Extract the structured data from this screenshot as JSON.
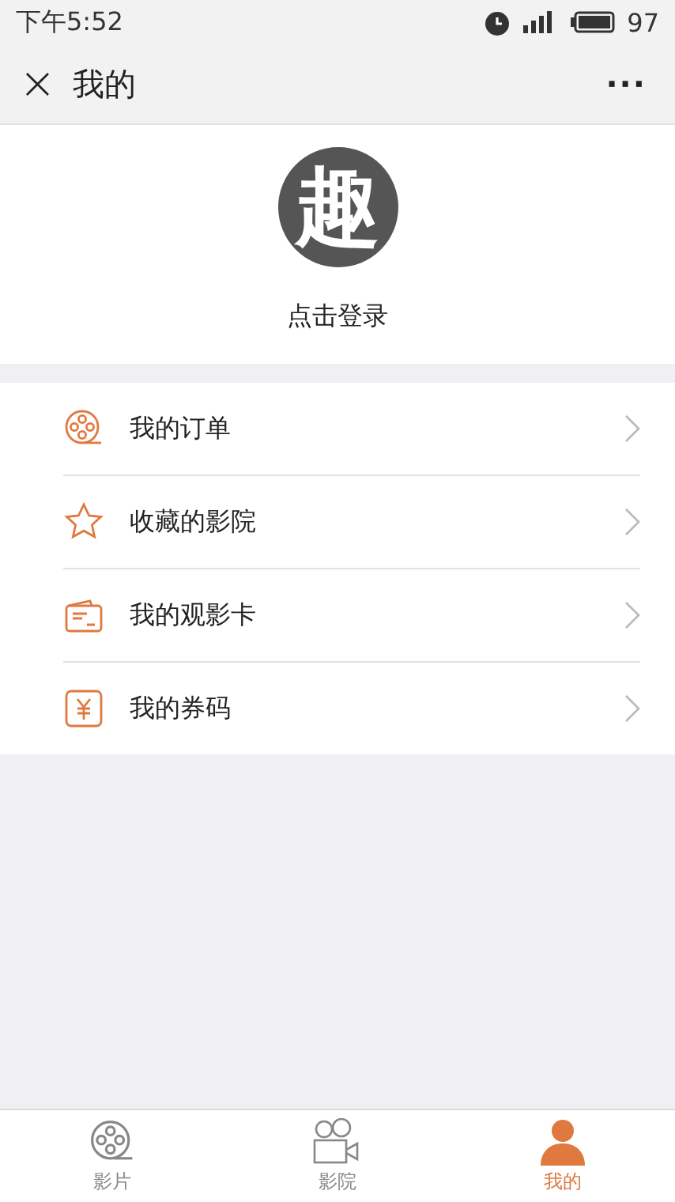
{
  "status_bar": {
    "time": "下午5:52",
    "battery": "97"
  },
  "header": {
    "close": "×",
    "title": "我的",
    "more": "···"
  },
  "profile": {
    "logo": "趣",
    "login": "点击登录"
  },
  "menu": [
    {
      "label": "我的订单"
    },
    {
      "label": "收藏的影院"
    },
    {
      "label": "我的观影卡"
    },
    {
      "label": "我的券码"
    }
  ],
  "tabs": [
    {
      "label": "影片",
      "selected": false
    },
    {
      "label": "影院",
      "selected": false
    },
    {
      "label": "我的",
      "selected": true
    }
  ]
}
